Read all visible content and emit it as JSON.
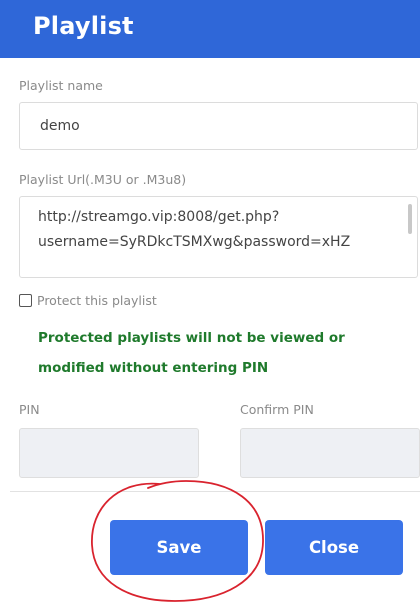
{
  "header": {
    "title": "Playlist"
  },
  "form": {
    "playlist_name_label": "Playlist name",
    "playlist_name_value": "demo",
    "playlist_url_label": "Playlist Url(.M3U or .M3u8)",
    "playlist_url_line1": "http://streamgo.vip:8008/get.php?",
    "playlist_url_line2": "username=SyRDkcTSMXwg&password=xHZ",
    "protect_label": "Protect this playlist",
    "protect_checked": false,
    "warning_line1": "Protected playlists will not be viewed or",
    "warning_line2": "modified without entering PIN",
    "pin_label": "PIN",
    "confirm_pin_label": "Confirm PIN"
  },
  "buttons": {
    "save_label": "Save",
    "close_label": "Close"
  },
  "colors": {
    "header": "#2f67d8",
    "button": "#3a73e8",
    "warning_text": "#1f7a2c",
    "annotation": "#d9232e"
  }
}
